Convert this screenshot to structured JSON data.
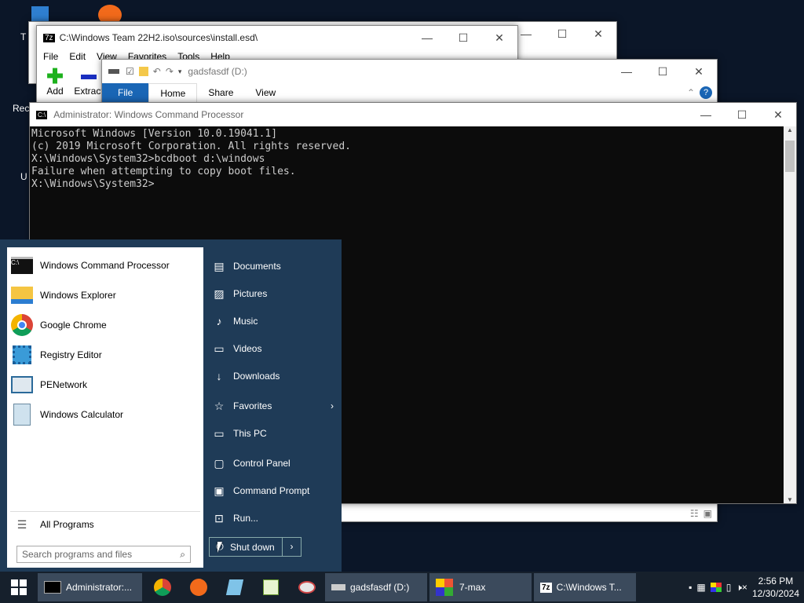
{
  "desktop": {
    "icon_labels": [
      "T",
      "Rec",
      "U"
    ]
  },
  "win7z": {
    "title": "C:\\Windows Team 22H2.iso\\sources\\install.esd\\",
    "menu": [
      "File",
      "Edit",
      "View",
      "Favorites",
      "Tools",
      "Help"
    ],
    "add_label": "Add",
    "extract_label": "Extract"
  },
  "explorer": {
    "title": "gadsfasdf (D:)",
    "tabs": [
      "File",
      "Home",
      "Share",
      "View"
    ]
  },
  "cmd": {
    "title": "Administrator: Windows Command Processor",
    "lines": [
      "Microsoft Windows [Version 10.0.19041.1]",
      "(c) 2019 Microsoft Corporation. All rights reserved.",
      "",
      "X:\\Windows\\System32>bcdboot d:\\windows",
      "Failure when attempting to copy boot files.",
      "",
      "X:\\Windows\\System32>"
    ]
  },
  "start": {
    "programs": [
      {
        "label": "Windows Command Processor",
        "icon": "cmd-icon"
      },
      {
        "label": "Windows Explorer",
        "icon": "folder-icon"
      },
      {
        "label": "Google Chrome",
        "icon": "chrome-icon"
      },
      {
        "label": "Registry Editor",
        "icon": "registry-icon"
      },
      {
        "label": "PENetwork",
        "icon": "network-icon"
      },
      {
        "label": "Windows Calculator",
        "icon": "calculator-icon"
      }
    ],
    "all_programs": "All Programs",
    "search_placeholder": "Search programs and files",
    "right": [
      {
        "label": "Documents",
        "icon": "document-icon"
      },
      {
        "label": "Pictures",
        "icon": "picture-icon"
      },
      {
        "label": "Music",
        "icon": "music-icon"
      },
      {
        "label": "Videos",
        "icon": "video-icon"
      },
      {
        "label": "Downloads",
        "icon": "download-icon"
      },
      {
        "label": "Favorites",
        "icon": "star-icon"
      },
      {
        "label": "This PC",
        "icon": "pc-icon"
      },
      {
        "label": "Control Panel",
        "icon": "control-panel-icon"
      },
      {
        "label": "Command Prompt",
        "icon": "cmd-prompt-icon"
      },
      {
        "label": "Run...",
        "icon": "run-icon"
      }
    ],
    "shutdown": "Shut down"
  },
  "taskbar": {
    "tasks": [
      "Administrator:...",
      "gadsfasdf (D:)",
      "7-max",
      "C:\\Windows T..."
    ],
    "time": "2:56 PM",
    "date": "12/30/2024"
  }
}
